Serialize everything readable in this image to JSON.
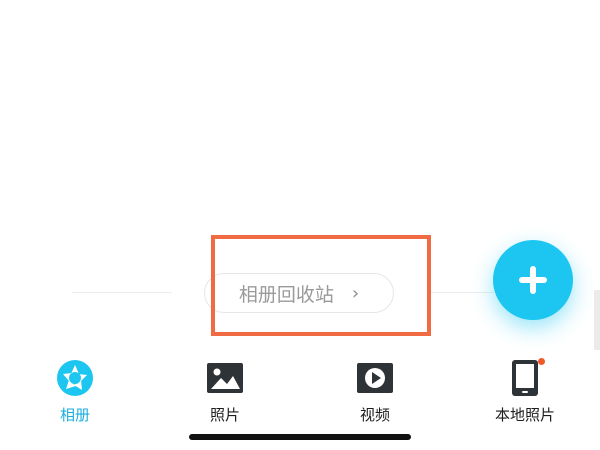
{
  "recycle_bin": {
    "label": "相册回收站",
    "chevron": "›"
  },
  "fab": {
    "icon": "plus-icon",
    "color": "#1cc6f1"
  },
  "tabs": [
    {
      "label": "相册",
      "icon": "album-icon",
      "active": true
    },
    {
      "label": "照片",
      "icon": "photo-icon",
      "active": false
    },
    {
      "label": "视频",
      "icon": "video-icon",
      "active": false
    },
    {
      "label": "本地照片",
      "icon": "phone-icon",
      "active": false,
      "badge": true
    }
  ],
  "colors": {
    "accent": "#1cc6f1",
    "active_tab": "#1aaee0",
    "highlight": "#f06a43",
    "badge": "#f05a28"
  }
}
